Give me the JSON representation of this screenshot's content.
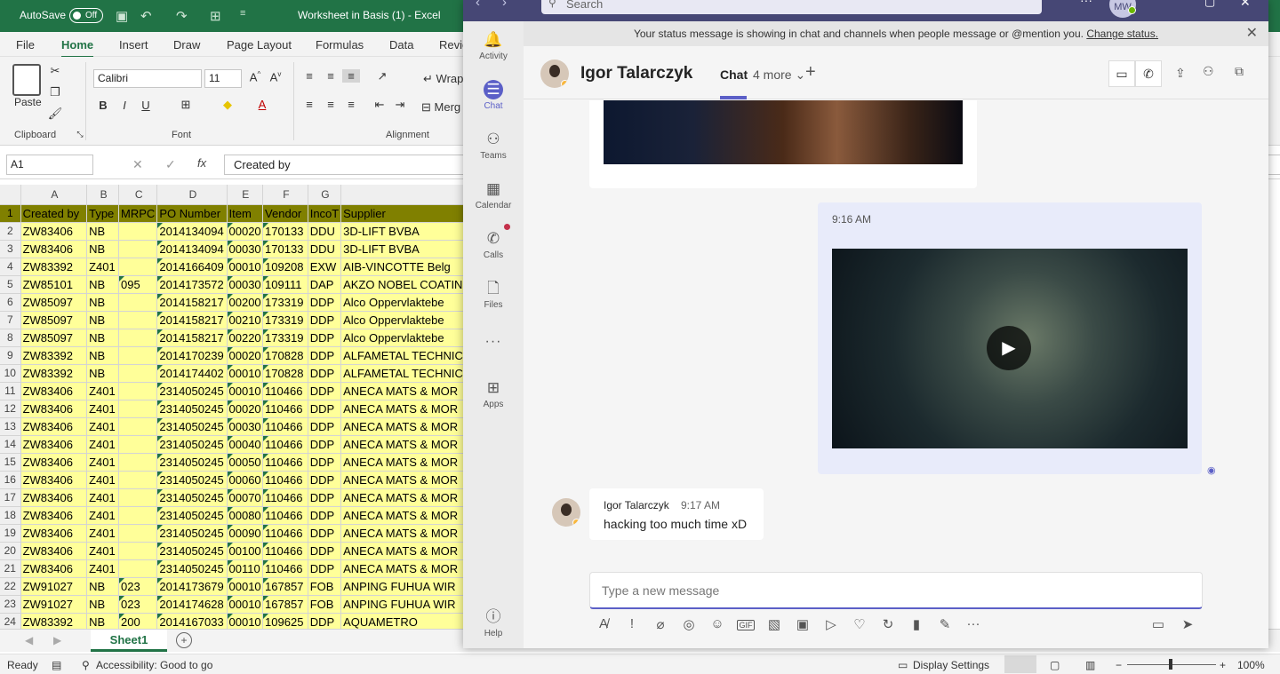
{
  "excel": {
    "autosave_label": "AutoSave",
    "autosave_state": "Off",
    "title": "Worksheet in Basis (1)  -  Excel",
    "tabs": [
      "File",
      "Home",
      "Insert",
      "Draw",
      "Page Layout",
      "Formulas",
      "Data",
      "Revie"
    ],
    "active_tab": "Home",
    "ribbon": {
      "paste": "Paste",
      "font_name": "Calibri",
      "font_size": "11",
      "wrap": "Wrap",
      "merge": "Merg",
      "groups": [
        "Clipboard",
        "Font",
        "Alignment"
      ]
    },
    "name_box": "A1",
    "formula": "Created by",
    "columns": [
      "A",
      "B",
      "C",
      "D",
      "E",
      "F",
      "G"
    ],
    "header_row": [
      "Created by",
      "Type",
      "MRPC",
      "PO Number",
      "Item",
      "Vendor",
      "IncoT",
      "Supplier"
    ],
    "rows": [
      [
        "ZW83406",
        "NB",
        "",
        "2014134094",
        "00020",
        "170133",
        "DDU",
        "3D-LIFT BVBA"
      ],
      [
        "ZW83406",
        "NB",
        "",
        "2014134094",
        "00030",
        "170133",
        "DDU",
        "3D-LIFT BVBA"
      ],
      [
        "ZW83392",
        "Z401",
        "",
        "2014166409",
        "00010",
        "109208",
        "EXW",
        "AIB-VINCOTTE  Belg"
      ],
      [
        "ZW85101",
        "NB",
        "095",
        "2014173572",
        "00030",
        "109111",
        "DAP",
        "AKZO NOBEL COATIN"
      ],
      [
        "ZW85097",
        "NB",
        "",
        "2014158217",
        "00200",
        "173319",
        "DDP",
        "Alco Oppervlaktebe"
      ],
      [
        "ZW85097",
        "NB",
        "",
        "2014158217",
        "00210",
        "173319",
        "DDP",
        "Alco Oppervlaktebe"
      ],
      [
        "ZW85097",
        "NB",
        "",
        "2014158217",
        "00220",
        "173319",
        "DDP",
        "Alco Oppervlaktebe"
      ],
      [
        "ZW83392",
        "NB",
        "",
        "2014170239",
        "00020",
        "170828",
        "DDP",
        "ALFAMETAL TECHNIC"
      ],
      [
        "ZW83392",
        "NB",
        "",
        "2014174402",
        "00010",
        "170828",
        "DDP",
        "ALFAMETAL TECHNIC"
      ],
      [
        "ZW83406",
        "Z401",
        "",
        "2314050245",
        "00010",
        "110466",
        "DDP",
        "ANECA MATS & MOR"
      ],
      [
        "ZW83406",
        "Z401",
        "",
        "2314050245",
        "00020",
        "110466",
        "DDP",
        "ANECA MATS & MOR"
      ],
      [
        "ZW83406",
        "Z401",
        "",
        "2314050245",
        "00030",
        "110466",
        "DDP",
        "ANECA MATS & MOR"
      ],
      [
        "ZW83406",
        "Z401",
        "",
        "2314050245",
        "00040",
        "110466",
        "DDP",
        "ANECA MATS & MOR"
      ],
      [
        "ZW83406",
        "Z401",
        "",
        "2314050245",
        "00050",
        "110466",
        "DDP",
        "ANECA MATS & MOR"
      ],
      [
        "ZW83406",
        "Z401",
        "",
        "2314050245",
        "00060",
        "110466",
        "DDP",
        "ANECA MATS & MOR"
      ],
      [
        "ZW83406",
        "Z401",
        "",
        "2314050245",
        "00070",
        "110466",
        "DDP",
        "ANECA MATS & MOR"
      ],
      [
        "ZW83406",
        "Z401",
        "",
        "2314050245",
        "00080",
        "110466",
        "DDP",
        "ANECA MATS & MOR"
      ],
      [
        "ZW83406",
        "Z401",
        "",
        "2314050245",
        "00090",
        "110466",
        "DDP",
        "ANECA MATS & MOR"
      ],
      [
        "ZW83406",
        "Z401",
        "",
        "2314050245",
        "00100",
        "110466",
        "DDP",
        "ANECA MATS & MOR"
      ],
      [
        "ZW83406",
        "Z401",
        "",
        "2314050245",
        "00110",
        "110466",
        "DDP",
        "ANECA MATS & MOR"
      ],
      [
        "ZW91027",
        "NB",
        "023",
        "2014173679",
        "00010",
        "167857",
        "FOB",
        "ANPING FUHUA WIR"
      ],
      [
        "ZW91027",
        "NB",
        "023",
        "2014174628",
        "00010",
        "167857",
        "FOB",
        "ANPING FUHUA WIR"
      ],
      [
        "ZW83392",
        "NB",
        "200",
        "2014167033",
        "00010",
        "109625",
        "DDP",
        "AQUAMETRO"
      ]
    ],
    "sheet_tab": "Sheet1",
    "status": {
      "ready": "Ready",
      "accessibility": "Accessibility: Good to go",
      "display_settings": "Display Settings",
      "zoom": "100%"
    }
  },
  "teams": {
    "search_placeholder": "Search",
    "user_initials": "MW",
    "rail": [
      {
        "label": "Activity",
        "icon": "bell-icon"
      },
      {
        "label": "Chat",
        "icon": "chat-icon"
      },
      {
        "label": "Teams",
        "icon": "teams-icon"
      },
      {
        "label": "Calendar",
        "icon": "calendar-icon"
      },
      {
        "label": "Calls",
        "icon": "phone-icon"
      },
      {
        "label": "Files",
        "icon": "file-icon"
      },
      {
        "label": "Apps",
        "icon": "apps-icon"
      },
      {
        "label": "Help",
        "icon": "help-icon"
      }
    ],
    "more_glyph": "···",
    "banner": {
      "text": "Your status message is showing in chat and channels when people message or @mention you.",
      "link": "Change status."
    },
    "header": {
      "name": "Igor Talarczyk",
      "chat_tab": "Chat",
      "more_tabs": "4 more"
    },
    "messages": {
      "my_time": "9:16 AM",
      "sender": "Igor Talarczyk",
      "sender_time": "9:17 AM",
      "sender_text": "hacking too much time xD"
    },
    "compose_placeholder": "Type a new message",
    "colors": {
      "accent": "#5b5fc7",
      "topbar": "#464775",
      "excel_green": "#217346",
      "header_fill": "#808000",
      "cell_fill": "#ffff99"
    }
  }
}
